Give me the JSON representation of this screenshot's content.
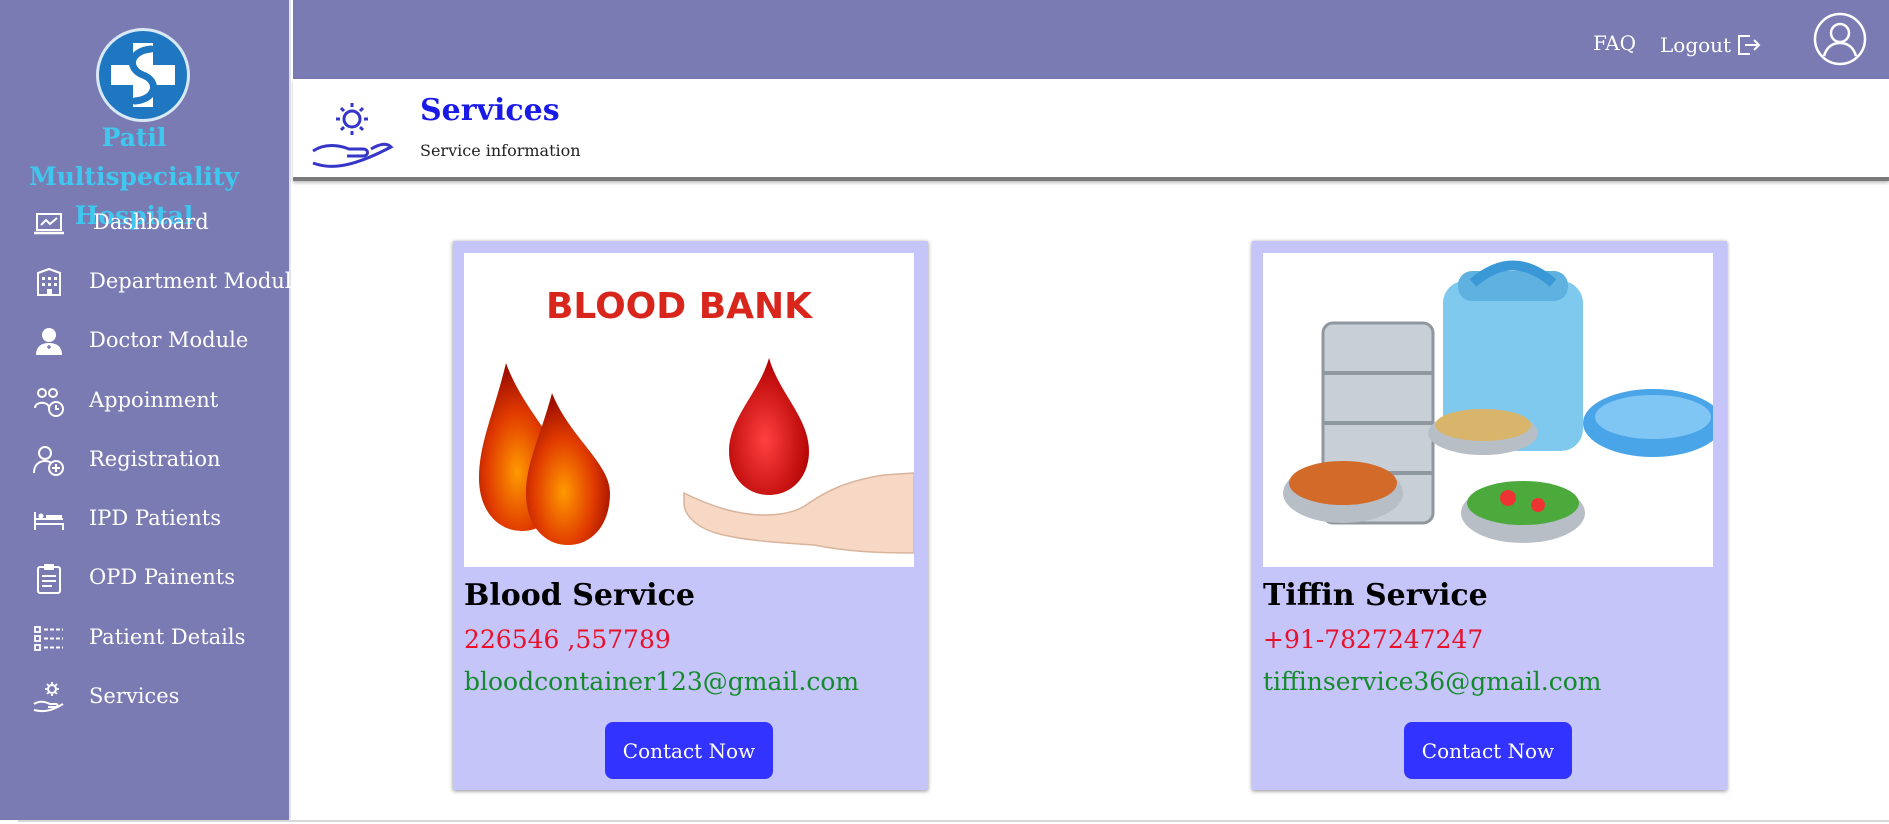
{
  "sidebar": {
    "hospital_name": "Patil Multispeciality Hospital",
    "items": [
      {
        "label": "Dashboard",
        "icon": "laptop-chart-icon"
      },
      {
        "label": "Department Module",
        "icon": "building-icon"
      },
      {
        "label": "Doctor Module",
        "icon": "doctor-icon"
      },
      {
        "label": "Appoinment",
        "icon": "appointment-icon"
      },
      {
        "label": "Registration",
        "icon": "user-add-icon"
      },
      {
        "label": "IPD Patients",
        "icon": "bed-icon"
      },
      {
        "label": "OPD Painents",
        "icon": "clipboard-icon"
      },
      {
        "label": "Patient Details",
        "icon": "list-icon"
      },
      {
        "label": "Services",
        "icon": "gear-hand-icon"
      }
    ]
  },
  "topbar": {
    "faq_label": "FAQ",
    "logout_label": "Logout"
  },
  "header": {
    "title": "Services",
    "subtitle": "Service information"
  },
  "services": [
    {
      "title": "Blood Service",
      "phone": "226546 ,557789",
      "email": "bloodcontainer123@gmail.com",
      "image_text": "BLOOD BANK",
      "button_label": "Contact Now"
    },
    {
      "title": "Tiffin Service",
      "phone": "+91-7827247247",
      "email": "tiffinservice36@gmail.com",
      "button_label": "Contact Now"
    }
  ],
  "colors": {
    "sidebar_bg": "#7b7bb3",
    "accent_title": "#1a1ae6",
    "card_bg": "#c5c5fa",
    "button_bg": "#3333ff",
    "phone_color": "#e8102a",
    "email_color": "#158a2c",
    "hospital_name_color": "#3ec8f0"
  }
}
